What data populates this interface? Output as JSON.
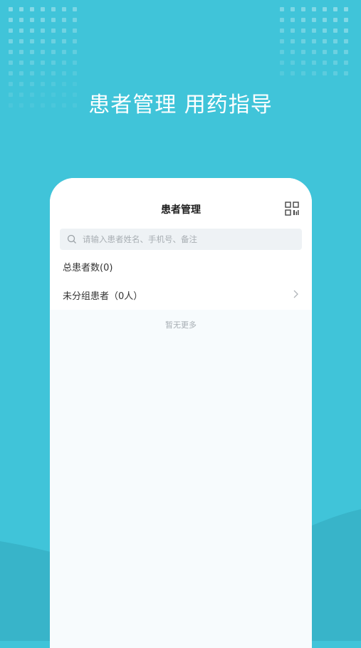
{
  "headline": "患者管理 用药指导",
  "screen": {
    "title": "患者管理",
    "search_placeholder": "请输入患者姓名、手机号、备注",
    "total_label": "总患者数(0)",
    "group": {
      "label": "未分组患者",
      "count": "（0人）"
    },
    "footer_text": "暂无更多"
  },
  "colors": {
    "background": "#40c4d9",
    "card": "#ffffff",
    "text": "#333333",
    "muted": "#a6adb3"
  }
}
